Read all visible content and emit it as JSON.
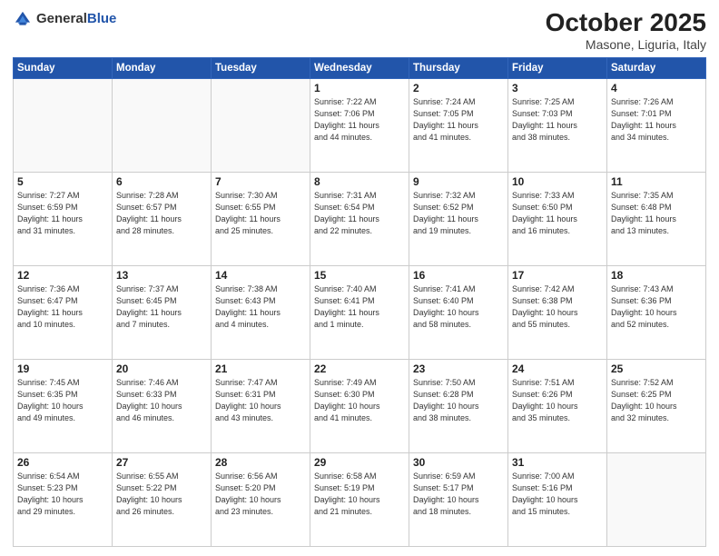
{
  "logo": {
    "general": "General",
    "blue": "Blue"
  },
  "title": "October 2025",
  "subtitle": "Masone, Liguria, Italy",
  "headers": [
    "Sunday",
    "Monday",
    "Tuesday",
    "Wednesday",
    "Thursday",
    "Friday",
    "Saturday"
  ],
  "weeks": [
    [
      {
        "day": "",
        "info": ""
      },
      {
        "day": "",
        "info": ""
      },
      {
        "day": "",
        "info": ""
      },
      {
        "day": "1",
        "info": "Sunrise: 7:22 AM\nSunset: 7:06 PM\nDaylight: 11 hours\nand 44 minutes."
      },
      {
        "day": "2",
        "info": "Sunrise: 7:24 AM\nSunset: 7:05 PM\nDaylight: 11 hours\nand 41 minutes."
      },
      {
        "day": "3",
        "info": "Sunrise: 7:25 AM\nSunset: 7:03 PM\nDaylight: 11 hours\nand 38 minutes."
      },
      {
        "day": "4",
        "info": "Sunrise: 7:26 AM\nSunset: 7:01 PM\nDaylight: 11 hours\nand 34 minutes."
      }
    ],
    [
      {
        "day": "5",
        "info": "Sunrise: 7:27 AM\nSunset: 6:59 PM\nDaylight: 11 hours\nand 31 minutes."
      },
      {
        "day": "6",
        "info": "Sunrise: 7:28 AM\nSunset: 6:57 PM\nDaylight: 11 hours\nand 28 minutes."
      },
      {
        "day": "7",
        "info": "Sunrise: 7:30 AM\nSunset: 6:55 PM\nDaylight: 11 hours\nand 25 minutes."
      },
      {
        "day": "8",
        "info": "Sunrise: 7:31 AM\nSunset: 6:54 PM\nDaylight: 11 hours\nand 22 minutes."
      },
      {
        "day": "9",
        "info": "Sunrise: 7:32 AM\nSunset: 6:52 PM\nDaylight: 11 hours\nand 19 minutes."
      },
      {
        "day": "10",
        "info": "Sunrise: 7:33 AM\nSunset: 6:50 PM\nDaylight: 11 hours\nand 16 minutes."
      },
      {
        "day": "11",
        "info": "Sunrise: 7:35 AM\nSunset: 6:48 PM\nDaylight: 11 hours\nand 13 minutes."
      }
    ],
    [
      {
        "day": "12",
        "info": "Sunrise: 7:36 AM\nSunset: 6:47 PM\nDaylight: 11 hours\nand 10 minutes."
      },
      {
        "day": "13",
        "info": "Sunrise: 7:37 AM\nSunset: 6:45 PM\nDaylight: 11 hours\nand 7 minutes."
      },
      {
        "day": "14",
        "info": "Sunrise: 7:38 AM\nSunset: 6:43 PM\nDaylight: 11 hours\nand 4 minutes."
      },
      {
        "day": "15",
        "info": "Sunrise: 7:40 AM\nSunset: 6:41 PM\nDaylight: 11 hours\nand 1 minute."
      },
      {
        "day": "16",
        "info": "Sunrise: 7:41 AM\nSunset: 6:40 PM\nDaylight: 10 hours\nand 58 minutes."
      },
      {
        "day": "17",
        "info": "Sunrise: 7:42 AM\nSunset: 6:38 PM\nDaylight: 10 hours\nand 55 minutes."
      },
      {
        "day": "18",
        "info": "Sunrise: 7:43 AM\nSunset: 6:36 PM\nDaylight: 10 hours\nand 52 minutes."
      }
    ],
    [
      {
        "day": "19",
        "info": "Sunrise: 7:45 AM\nSunset: 6:35 PM\nDaylight: 10 hours\nand 49 minutes."
      },
      {
        "day": "20",
        "info": "Sunrise: 7:46 AM\nSunset: 6:33 PM\nDaylight: 10 hours\nand 46 minutes."
      },
      {
        "day": "21",
        "info": "Sunrise: 7:47 AM\nSunset: 6:31 PM\nDaylight: 10 hours\nand 43 minutes."
      },
      {
        "day": "22",
        "info": "Sunrise: 7:49 AM\nSunset: 6:30 PM\nDaylight: 10 hours\nand 41 minutes."
      },
      {
        "day": "23",
        "info": "Sunrise: 7:50 AM\nSunset: 6:28 PM\nDaylight: 10 hours\nand 38 minutes."
      },
      {
        "day": "24",
        "info": "Sunrise: 7:51 AM\nSunset: 6:26 PM\nDaylight: 10 hours\nand 35 minutes."
      },
      {
        "day": "25",
        "info": "Sunrise: 7:52 AM\nSunset: 6:25 PM\nDaylight: 10 hours\nand 32 minutes."
      }
    ],
    [
      {
        "day": "26",
        "info": "Sunrise: 6:54 AM\nSunset: 5:23 PM\nDaylight: 10 hours\nand 29 minutes."
      },
      {
        "day": "27",
        "info": "Sunrise: 6:55 AM\nSunset: 5:22 PM\nDaylight: 10 hours\nand 26 minutes."
      },
      {
        "day": "28",
        "info": "Sunrise: 6:56 AM\nSunset: 5:20 PM\nDaylight: 10 hours\nand 23 minutes."
      },
      {
        "day": "29",
        "info": "Sunrise: 6:58 AM\nSunset: 5:19 PM\nDaylight: 10 hours\nand 21 minutes."
      },
      {
        "day": "30",
        "info": "Sunrise: 6:59 AM\nSunset: 5:17 PM\nDaylight: 10 hours\nand 18 minutes."
      },
      {
        "day": "31",
        "info": "Sunrise: 7:00 AM\nSunset: 5:16 PM\nDaylight: 10 hours\nand 15 minutes."
      },
      {
        "day": "",
        "info": ""
      }
    ]
  ]
}
